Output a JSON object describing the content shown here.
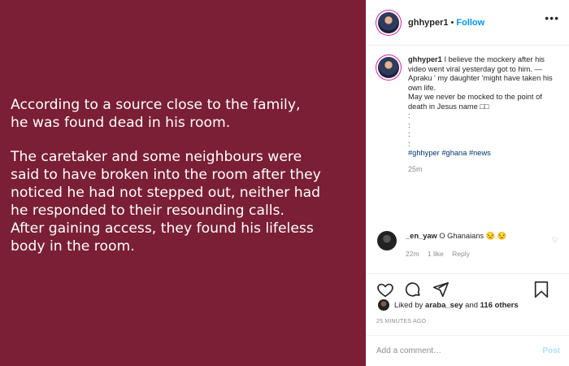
{
  "media": {
    "bg_color": "#7a1f35",
    "paragraphs": [
      "According to a source close to the family,\nhe was found dead in his room.",
      "The caretaker and some neighbours were\nsaid to have broken into the room after they\nnoticed he had not stepped out, neither had\nhe responded to their resounding calls.\nAfter gaining access, they found his lifeless\nbody in the room."
    ]
  },
  "header": {
    "username": "ghhyper1",
    "separator": "•",
    "follow_label": "Follow",
    "more_icon": "more-options-icon"
  },
  "caption": {
    "username": "ghhyper1",
    "lines": [
      "I believe the mockery after his video went viral yesterday got to him. —",
      "Apraku ' my daughter 'might have taken his own life.",
      "May we never be mocked to the point of death in Jesus name □□",
      ":",
      ":",
      ":",
      ":"
    ],
    "hashtags": "#ghhyper #ghana #news",
    "time": "25m"
  },
  "comment": {
    "username": "_en_yaw",
    "text": "O Ghanaians 😒 😒",
    "time": "22m",
    "likes": "1 like",
    "reply_label": "Reply"
  },
  "actions": {
    "icons": [
      "heart-icon",
      "comment-icon",
      "share-icon",
      "bookmark-icon"
    ]
  },
  "likes": {
    "prefix": "Liked by",
    "user": "araba_sey",
    "and": "and",
    "count": "116 others"
  },
  "timestamp": "25 MINUTES AGO",
  "add_comment": {
    "placeholder": "Add a comment…",
    "post_label": "Post"
  }
}
